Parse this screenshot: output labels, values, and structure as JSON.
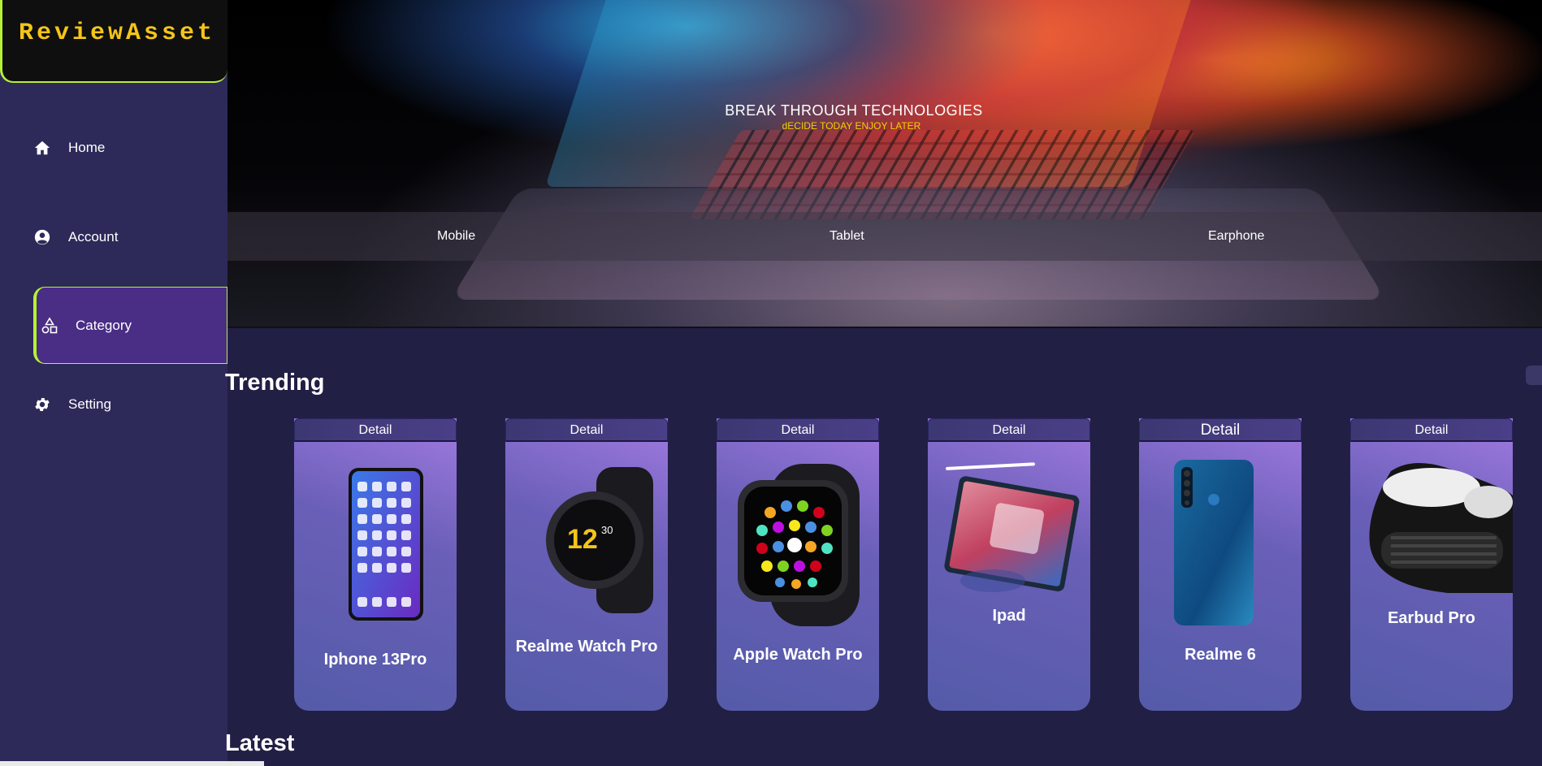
{
  "app": {
    "logo": "ReviewAsset"
  },
  "sidebar": {
    "items": [
      {
        "label": "Home",
        "icon": "home-icon"
      },
      {
        "label": "Account",
        "icon": "account-icon"
      },
      {
        "label": "Category",
        "icon": "category-shapes-icon",
        "active": true
      },
      {
        "label": "Setting",
        "icon": "gear-icon"
      }
    ]
  },
  "hero": {
    "title": "BREAK THROUGH TECHNOLOGIES",
    "subtitle": "dECIDE TODAY ENJOY LATER",
    "categories": [
      "Mobile",
      "Tablet",
      "Earphone"
    ]
  },
  "sections": {
    "trending": "Trending",
    "latest": "Latest"
  },
  "trending_cards": [
    {
      "button": "Detail",
      "name": "Iphone 13Pro"
    },
    {
      "button": "Detail",
      "name": "Realme Watch Pro"
    },
    {
      "button": "Detail",
      "name": "Apple Watch Pro"
    },
    {
      "button": "Detail",
      "name": "Ipad"
    },
    {
      "button": "Detail",
      "name": "Realme 6"
    },
    {
      "button": "Detail",
      "name": "Earbud Pro"
    }
  ],
  "colors": {
    "accent": "#b6f233",
    "logo_text": "#f5c518",
    "sidebar_bg": "#2d2a5a",
    "active_bg": "#4a2d85",
    "page_bg": "#221f45",
    "subtitle": "#f5d000"
  }
}
